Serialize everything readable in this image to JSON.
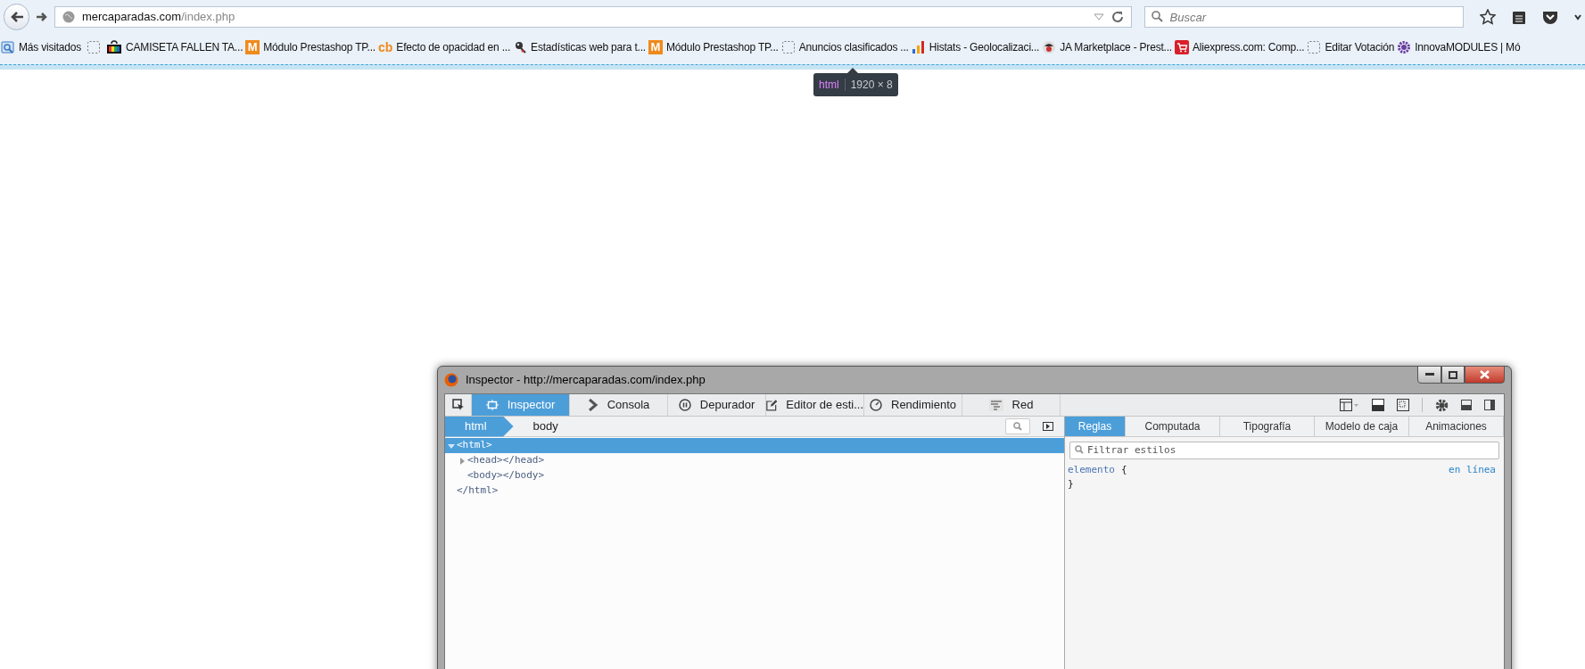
{
  "browser": {
    "url_host": "mercaparadas.com",
    "url_path": "/index.php",
    "search": {
      "placeholder": "Buscar"
    }
  },
  "bookmarks": [
    {
      "label": "Más visitados"
    },
    {
      "label": "CAMISETA FALLEN TA..."
    },
    {
      "logo": "M",
      "label": "Módulo Prestashop TP..."
    },
    {
      "logo": "cb",
      "label": "Efecto de opacidad en ..."
    },
    {
      "label": "Estadísticas web para t..."
    },
    {
      "logo": "M",
      "label": "Módulo Prestashop TP..."
    },
    {
      "label": "Anuncios clasificados ..."
    },
    {
      "label": "Histats - Geolocalizaci..."
    },
    {
      "label": "JA Marketplace - Prest..."
    },
    {
      "label": "Aliexpress.com: Comp..."
    },
    {
      "label": "Editar Votación"
    },
    {
      "label": "InnovaMODULES | Mó"
    }
  ],
  "highlighter_tooltip": {
    "tag": "html",
    "size": "1920 × 8"
  },
  "devtools": {
    "title": "Inspector - http://mercaparadas.com/index.php",
    "tabs": [
      {
        "label": "Inspector",
        "selected": true
      },
      {
        "label": "Consola",
        "selected": false
      },
      {
        "label": "Depurador",
        "selected": false
      },
      {
        "label": "Editor de esti...",
        "selected": false
      },
      {
        "label": "Rendimiento",
        "selected": false
      },
      {
        "label": "Red",
        "selected": false
      }
    ],
    "breadcrumbs": [
      {
        "label": "html",
        "selected": true
      },
      {
        "label": "body",
        "selected": false
      }
    ],
    "markup": [
      {
        "open": "<html>",
        "close": "</html>",
        "expanded": true,
        "selected": true,
        "children": [
          {
            "open": "<head></head>",
            "collapsible": true,
            "expanded": false,
            "selected": false
          },
          {
            "open": "<body></body>",
            "collapsible": false,
            "selected": false
          }
        ]
      }
    ],
    "side_tabs": [
      {
        "label": "Reglas",
        "selected": true
      },
      {
        "label": "Computada",
        "selected": false
      },
      {
        "label": "Tipografía",
        "selected": false
      },
      {
        "label": "Modelo de caja",
        "selected": false
      },
      {
        "label": "Animaciones",
        "selected": false
      }
    ],
    "filter": {
      "placeholder": "Filtrar estilos"
    },
    "rule": {
      "selector": "elemento",
      "open": "{",
      "close": "}",
      "source": "en línea"
    }
  }
}
